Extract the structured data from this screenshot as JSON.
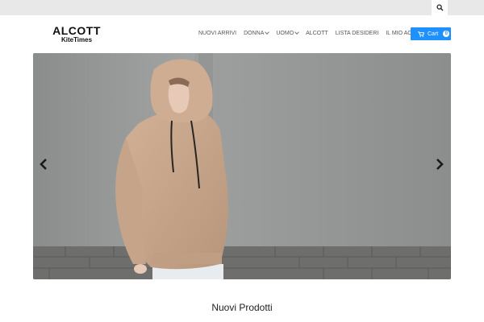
{
  "header": {
    "logo_main": "ALCOTT",
    "logo_sub": "KiteTimes",
    "search_icon": "search-icon"
  },
  "nav": {
    "items": [
      {
        "label": "NUOVI ARRIVI",
        "dropdown": false
      },
      {
        "label": "DONNA",
        "dropdown": true
      },
      {
        "label": "UOMO",
        "dropdown": true
      },
      {
        "label": "ALCOTT",
        "dropdown": false
      },
      {
        "label": "LISTA DESIDERI",
        "dropdown": false
      },
      {
        "label": "IL MIO ACCOUNT",
        "dropdown": false
      }
    ]
  },
  "cart": {
    "label": "Cart",
    "count": "0",
    "icon": "cart-icon",
    "color": "#1e90ff"
  },
  "slider": {
    "image_description_icon": "hero-photo",
    "prev_icon": "chevron-left-icon",
    "next_icon": "chevron-right-icon"
  },
  "section": {
    "title": "Nuovi Prodotti"
  }
}
